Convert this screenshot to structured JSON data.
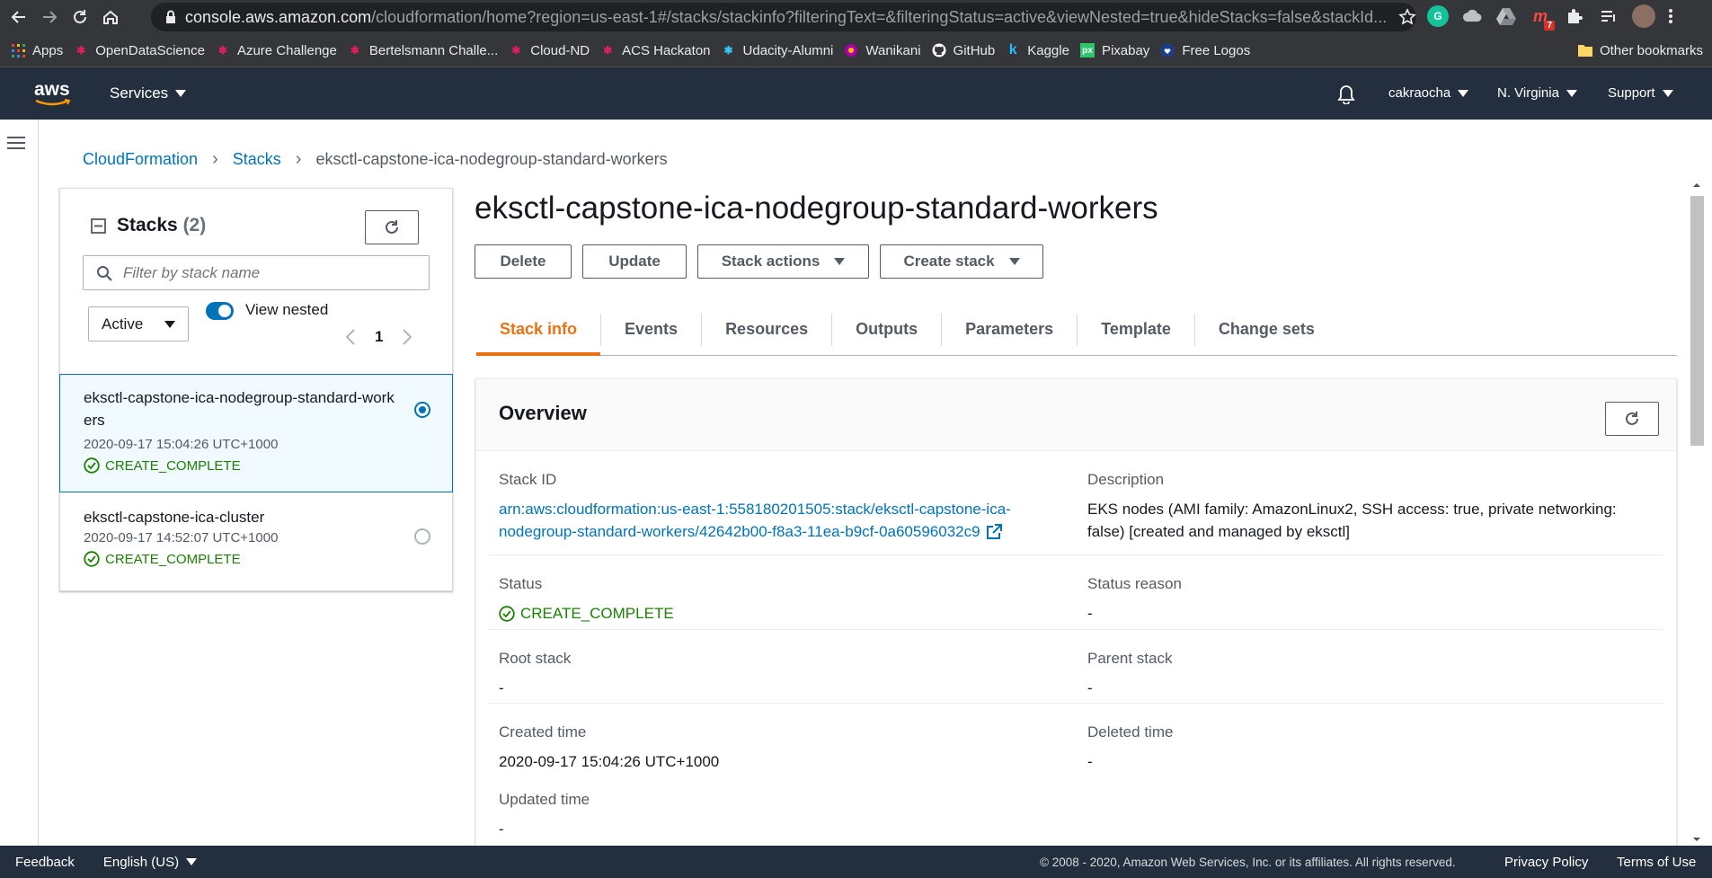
{
  "browser": {
    "url_host": "console.aws.amazon.com",
    "url_path": "/cloudformation/home?region=us-east-1#/stacks/stackinfo?filteringText=&filteringStatus=active&viewNested=true&hideStacks=false&stackId...",
    "ext_badge": "7"
  },
  "bookmarks": [
    {
      "label": "Apps",
      "icon": "apps-grid-icon",
      "color": "#ea4335"
    },
    {
      "label": "OpenDataScience",
      "icon": "slack-icon",
      "color": "#e01e5a"
    },
    {
      "label": "Azure Challenge",
      "icon": "slack-icon",
      "color": "#e01e5a"
    },
    {
      "label": "Bertelsmann Challe...",
      "icon": "slack-icon",
      "color": "#e01e5a"
    },
    {
      "label": "Cloud-ND",
      "icon": "slack-icon",
      "color": "#e01e5a"
    },
    {
      "label": "ACS Hackaton",
      "icon": "slack-icon",
      "color": "#e01e5a"
    },
    {
      "label": "Udacity-Alumni",
      "icon": "slack-color-icon",
      "color": "#36c5f0"
    },
    {
      "label": "Wanikani",
      "icon": "wanikani-icon",
      "color": "#f0a"
    },
    {
      "label": "GitHub",
      "icon": "github-icon",
      "color": "#ffffff"
    },
    {
      "label": "Kaggle",
      "icon": "kaggle-icon",
      "color": "#20beff"
    },
    {
      "label": "Pixabay",
      "icon": "pixabay-icon",
      "color": "#2ec66d"
    },
    {
      "label": "Free Logos",
      "icon": "heart-icon",
      "color": "#1a3d8f"
    }
  ],
  "other_bookmarks": "Other bookmarks",
  "aws_header": {
    "logo": "aws",
    "services": "Services",
    "user": "cakraocha",
    "region": "N. Virginia",
    "support": "Support"
  },
  "breadcrumb": {
    "root": "CloudFormation",
    "stacks": "Stacks",
    "current": "eksctl-capstone-ica-nodegroup-standard-workers"
  },
  "stacks_panel": {
    "title": "Stacks",
    "count": "(2)",
    "filter_placeholder": "Filter by stack name",
    "status_filter": "Active",
    "view_nested_label": "View nested",
    "view_nested": true,
    "page": "1",
    "items": [
      {
        "name": "eksctl-capstone-ica-nodegroup-standard-workers",
        "time": "2020-09-17 15:04:26 UTC+1000",
        "status": "CREATE_COMPLETE",
        "selected": true
      },
      {
        "name": "eksctl-capstone-ica-cluster",
        "time": "2020-09-17 14:52:07 UTC+1000",
        "status": "CREATE_COMPLETE",
        "selected": false
      }
    ]
  },
  "main": {
    "title": "eksctl-capstone-ica-nodegroup-standard-workers",
    "actions": {
      "delete": "Delete",
      "update": "Update",
      "stack_actions": "Stack actions",
      "create_stack": "Create stack"
    },
    "tabs": [
      "Stack info",
      "Events",
      "Resources",
      "Outputs",
      "Parameters",
      "Template",
      "Change sets"
    ],
    "active_tab": "Stack info"
  },
  "overview": {
    "title": "Overview",
    "stack_id_label": "Stack ID",
    "stack_id_line1": "arn:aws:cloudformation:us-east-1:558180201505:stack/eksctl-capstone-ica-",
    "stack_id_line2": "nodegroup-standard-workers/42642b00-f8a3-11ea-b9cf-0a60596032c9",
    "description_label": "Description",
    "description_line1": "EKS nodes (AMI family: AmazonLinux2, SSH access: true, private networking:",
    "description_line2": "false) [created and managed by eksctl]",
    "status_label": "Status",
    "status_value": "CREATE_COMPLETE",
    "status_reason_label": "Status reason",
    "status_reason_value": "-",
    "root_stack_label": "Root stack",
    "root_stack_value": "-",
    "parent_stack_label": "Parent stack",
    "parent_stack_value": "-",
    "created_time_label": "Created time",
    "created_time_value": "2020-09-17 15:04:26 UTC+1000",
    "deleted_time_label": "Deleted time",
    "deleted_time_value": "-",
    "updated_time_label": "Updated time",
    "updated_time_value": "-"
  },
  "footer": {
    "feedback": "Feedback",
    "language": "English (US)",
    "copyright": "© 2008 - 2020, Amazon Web Services, Inc. or its affiliates. All rights reserved.",
    "privacy": "Privacy Policy",
    "terms": "Terms of Use"
  },
  "colors": {
    "aws_nav": "#232f3e",
    "link": "#0073bb",
    "success": "#1d8102",
    "active_tab": "#ec7211"
  }
}
